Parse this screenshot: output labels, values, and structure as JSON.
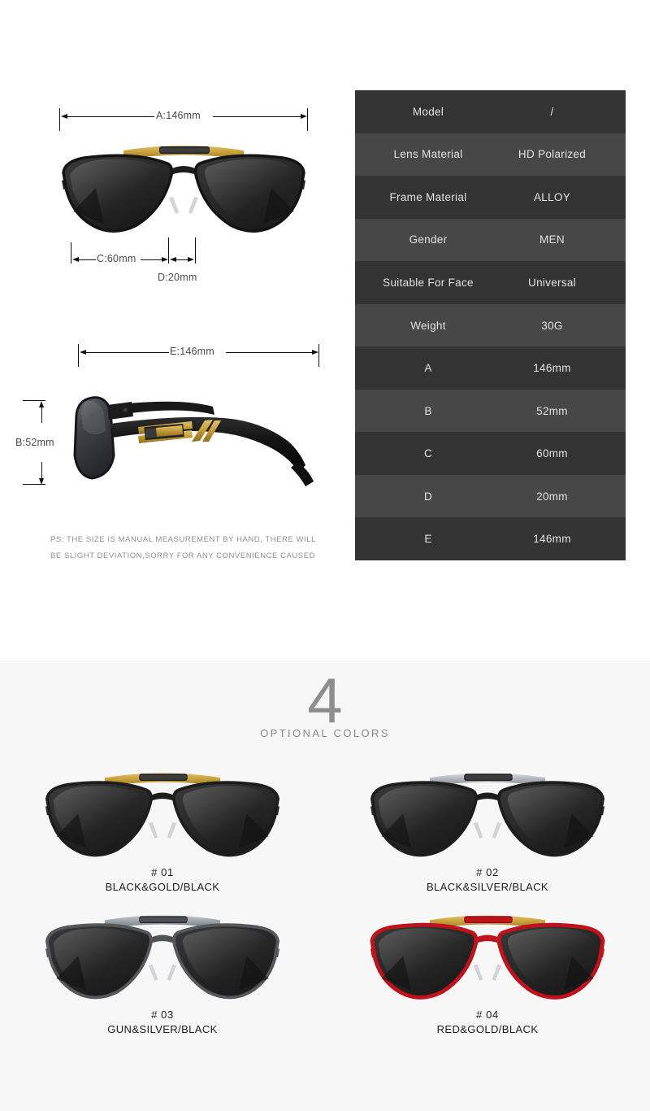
{
  "spec": {
    "table": {
      "rows": [
        {
          "key": "Model",
          "value": "/"
        },
        {
          "key": "Lens Material",
          "value": "HD Polarized"
        },
        {
          "key": "Frame Material",
          "value": "ALLOY"
        },
        {
          "key": "Gender",
          "value": "MEN"
        },
        {
          "key": "Suitable For Face",
          "value": "Universal"
        },
        {
          "key": "Weight",
          "value": "30G"
        },
        {
          "key": "A",
          "value": "146mm"
        },
        {
          "key": "B",
          "value": "52mm"
        },
        {
          "key": "C",
          "value": "60mm"
        },
        {
          "key": "D",
          "value": "20mm"
        },
        {
          "key": "E",
          "value": "146mm"
        }
      ]
    },
    "dimensions": {
      "a": "A:146mm",
      "b": "B:52mm",
      "c": "C:60mm",
      "d": "D:20mm",
      "e": "E:146mm"
    },
    "note_line1": "PS: THE SIZE IS MANUAL MEASUREMENT BY HAND, THERE WILL",
    "note_line2": "BE SLIGHT DEVIATION,SORRY FOR ANY CONVENIENCE CAUSED"
  },
  "colors": {
    "count": "4",
    "caption": "OPTIONAL COLORS",
    "swatches": [
      {
        "code": "#  01",
        "name": "BLACK&GOLD/BLACK",
        "frame": "#1d1d1d",
        "brow": "#c8a13c",
        "lens": "#2b2b2b"
      },
      {
        "code": "#  02",
        "name": "BLACK&SILVER/BLACK",
        "frame": "#1d1d1d",
        "brow": "#b9bcc0",
        "lens": "#2b2b2b"
      },
      {
        "code": "#  03",
        "name": "GUN&SILVER/BLACK",
        "frame": "#54585c",
        "brow": "#9ea3a8",
        "lens": "#2b2b2b"
      },
      {
        "code": "#  04",
        "name": "RED&GOLD/BLACK",
        "frame": "#c0121c",
        "brow": "#c8a13c",
        "lens": "#2b2b2b"
      }
    ]
  },
  "palette": {
    "table_row_dark": "#333333",
    "table_row_light": "#474747",
    "table_text": "#e2e2e2",
    "page_bg": "#ffffff",
    "colors_bg": "#f7f7f7",
    "dim_line": "#111111",
    "dim_text": "#4a4a4a",
    "note_text": "#8d8d8d"
  }
}
